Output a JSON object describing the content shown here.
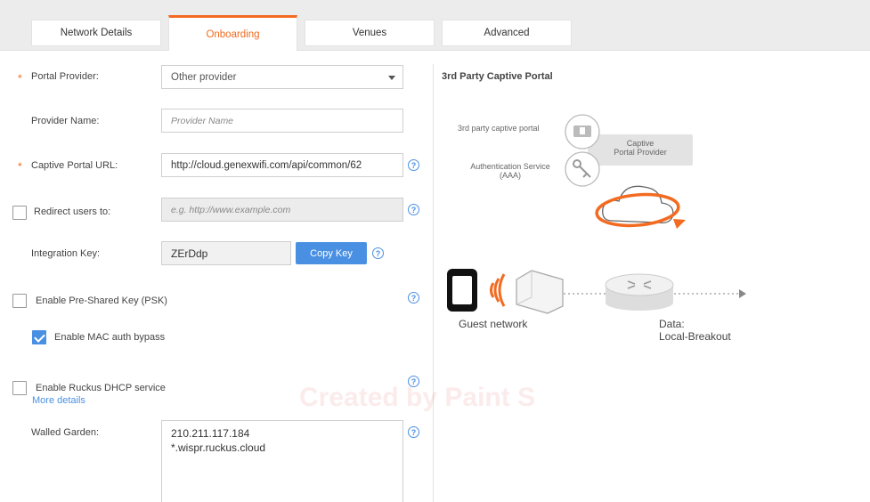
{
  "tabs": [
    {
      "label": "Network Details",
      "active": false
    },
    {
      "label": "Onboarding",
      "active": true
    },
    {
      "label": "Venues",
      "active": false
    },
    {
      "label": "Advanced",
      "active": false
    }
  ],
  "form": {
    "required_mark": "*",
    "portal_provider": {
      "label": "Portal Provider:",
      "value": "Other provider"
    },
    "provider_name": {
      "label": "Provider Name:",
      "placeholder": "Provider Name"
    },
    "captive_portal_url": {
      "label": "Captive Portal URL:",
      "value": "http://cloud.genexwifi.com/api/common/62"
    },
    "redirect_users": {
      "label": "Redirect users to:",
      "placeholder": "e.g. http://www.example.com",
      "checked": false
    },
    "integration_key": {
      "label": "Integration Key:",
      "value": "ZErDdp",
      "copy_label": "Copy Key"
    },
    "psk": {
      "label": "Enable Pre-Shared Key (PSK)",
      "checked": false
    },
    "mac_auth": {
      "label": "Enable MAC auth bypass",
      "checked": true
    },
    "dhcp": {
      "label": "Enable Ruckus DHCP service",
      "checked": false,
      "more_details": "More details"
    },
    "walled_garden": {
      "label": "Walled Garden:",
      "entries": [
        "210.211.117.184",
        "*.wispr.ruckus.cloud"
      ]
    },
    "help_glyph": "?"
  },
  "diagram": {
    "title": "3rd Party Captive Portal",
    "captive_portal_label": "3rd party captive portal",
    "auth_service_line1": "Authentication Service",
    "auth_service_line2": "(AAA)",
    "provider_box_line1": "Captive",
    "provider_box_line2": "Portal Provider",
    "guest_network": "Guest network",
    "data_line1": "Data:",
    "data_line2": "Local-Breakout"
  },
  "watermark": "Created by Paint S",
  "colors": {
    "accent": "#f26b21",
    "link": "#4a90e2",
    "tabbar": "#ececec"
  }
}
